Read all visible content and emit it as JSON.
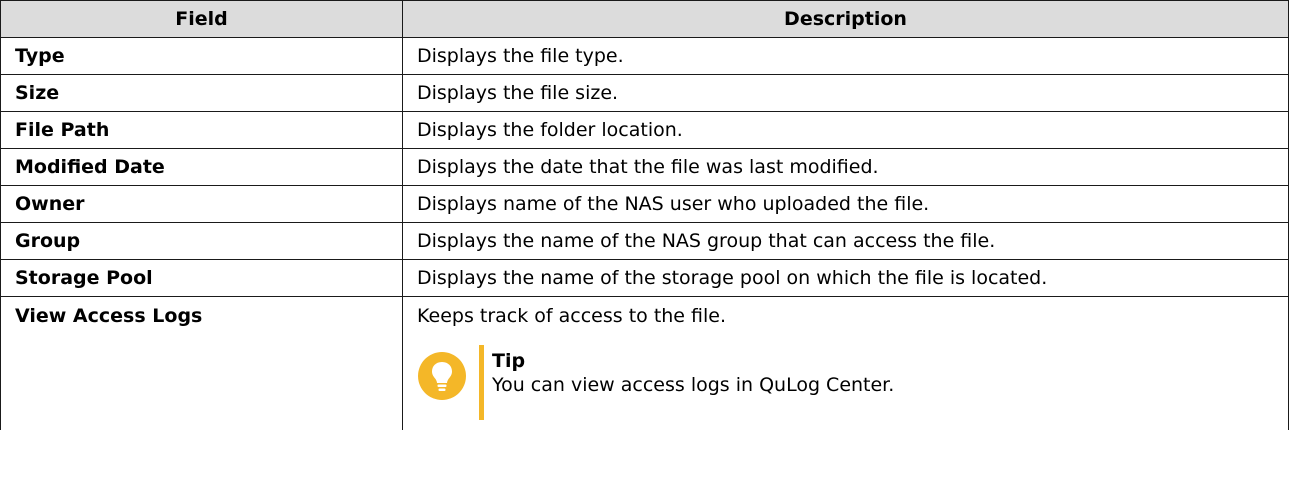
{
  "table": {
    "headers": {
      "field": "Field",
      "description": "Description"
    },
    "rows": [
      {
        "field": "Type",
        "description": "Displays the file type."
      },
      {
        "field": "Size",
        "description": "Displays the file size."
      },
      {
        "field": "File Path",
        "description": "Displays the folder location."
      },
      {
        "field": "Modified Date",
        "description": "Displays the date that the file was last modified."
      },
      {
        "field": "Owner",
        "description": "Displays name of the NAS user who uploaded the file."
      },
      {
        "field": "Group",
        "description": "Displays the name of the NAS group that can access the file."
      },
      {
        "field": "Storage Pool",
        "description": "Displays the name of the storage pool on which the file is located."
      },
      {
        "field": "View Access Logs",
        "description": "Keeps track of access to the file."
      }
    ]
  },
  "tip": {
    "icon": "lightbulb-icon",
    "title": "Tip",
    "text": "You can view access logs in QuLog Center.",
    "accent_color": "#f4b728"
  },
  "colors": {
    "header_bg": "#dcdcdc",
    "border": "#1a1a1a"
  }
}
